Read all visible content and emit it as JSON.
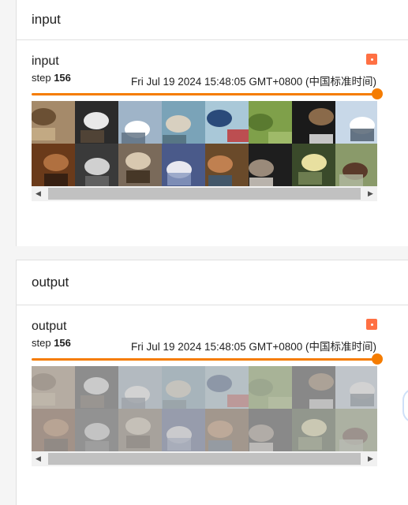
{
  "sections": [
    {
      "header": "input",
      "card": {
        "title": "input",
        "step_label": "step",
        "step_value": "156",
        "timestamp": "Fri Jul 19 2024 15:48:05 GMT+0800 (中国标准时间)",
        "slider_fraction": 1.0,
        "swatch_color": "#ff7043"
      }
    },
    {
      "header": "output",
      "card": {
        "title": "output",
        "step_label": "step",
        "step_value": "156",
        "timestamp": "Fri Jul 19 2024 15:48:05 GMT+0800 (中国标准时间)",
        "slider_fraction": 1.0,
        "swatch_color": "#ff7043"
      }
    }
  ],
  "accent_color": "#f57c00",
  "scrollbar": {
    "left_arrow": "◀",
    "right_arrow": "▶"
  }
}
